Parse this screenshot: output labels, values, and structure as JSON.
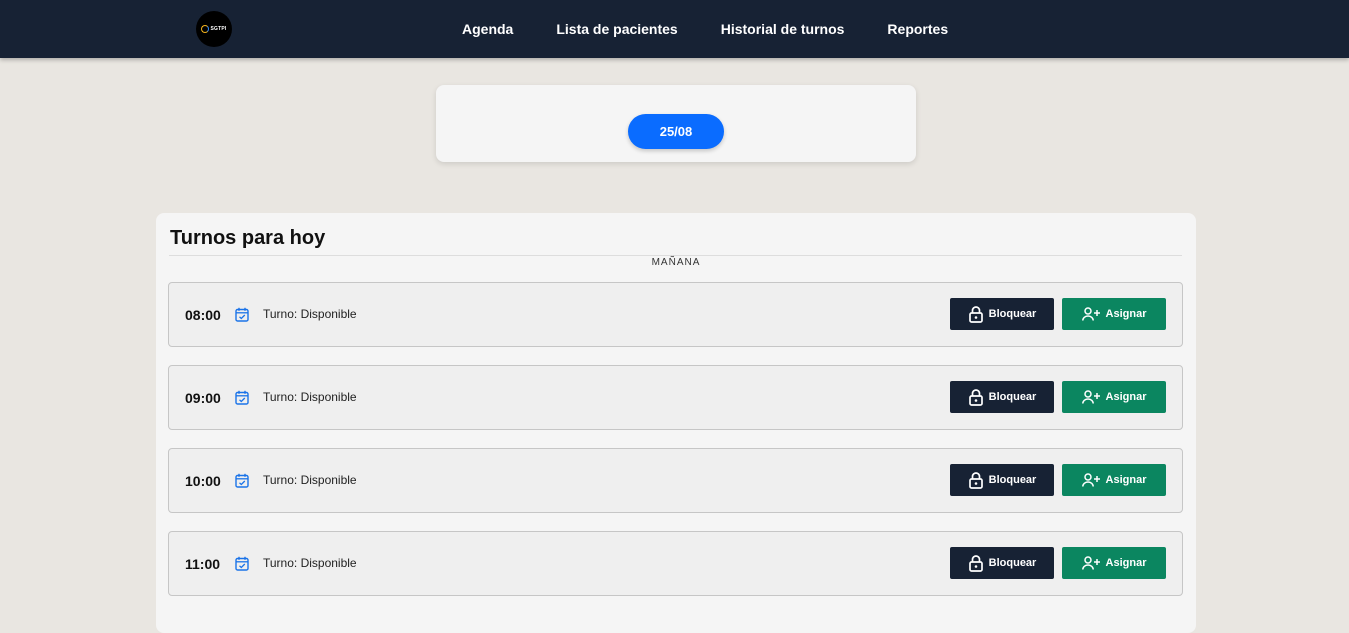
{
  "nav": {
    "logo_text": "SGTPI",
    "items": [
      {
        "label": "Agenda"
      },
      {
        "label": "Lista de pacientes"
      },
      {
        "label": "Historial de turnos"
      },
      {
        "label": "Reportes"
      }
    ]
  },
  "date_selector": {
    "label": "25/08"
  },
  "schedule": {
    "title": "Turnos para hoy",
    "section_label": "MAÑANA",
    "block_label": "Bloquear",
    "assign_label": "Asignar",
    "slots": [
      {
        "time": "08:00",
        "status": "Turno: Disponible"
      },
      {
        "time": "09:00",
        "status": "Turno: Disponible"
      },
      {
        "time": "10:00",
        "status": "Turno: Disponible"
      },
      {
        "time": "11:00",
        "status": "Turno: Disponible"
      }
    ]
  },
  "colors": {
    "topbar": "#172234",
    "accent_blue": "#0a6cff",
    "assign_green": "#0b8660",
    "block_dark": "#172234",
    "background": "#e9e6e1"
  },
  "icons": {
    "slot": "calendar-check-icon",
    "block": "lock-icon",
    "assign": "user-plus-icon"
  }
}
